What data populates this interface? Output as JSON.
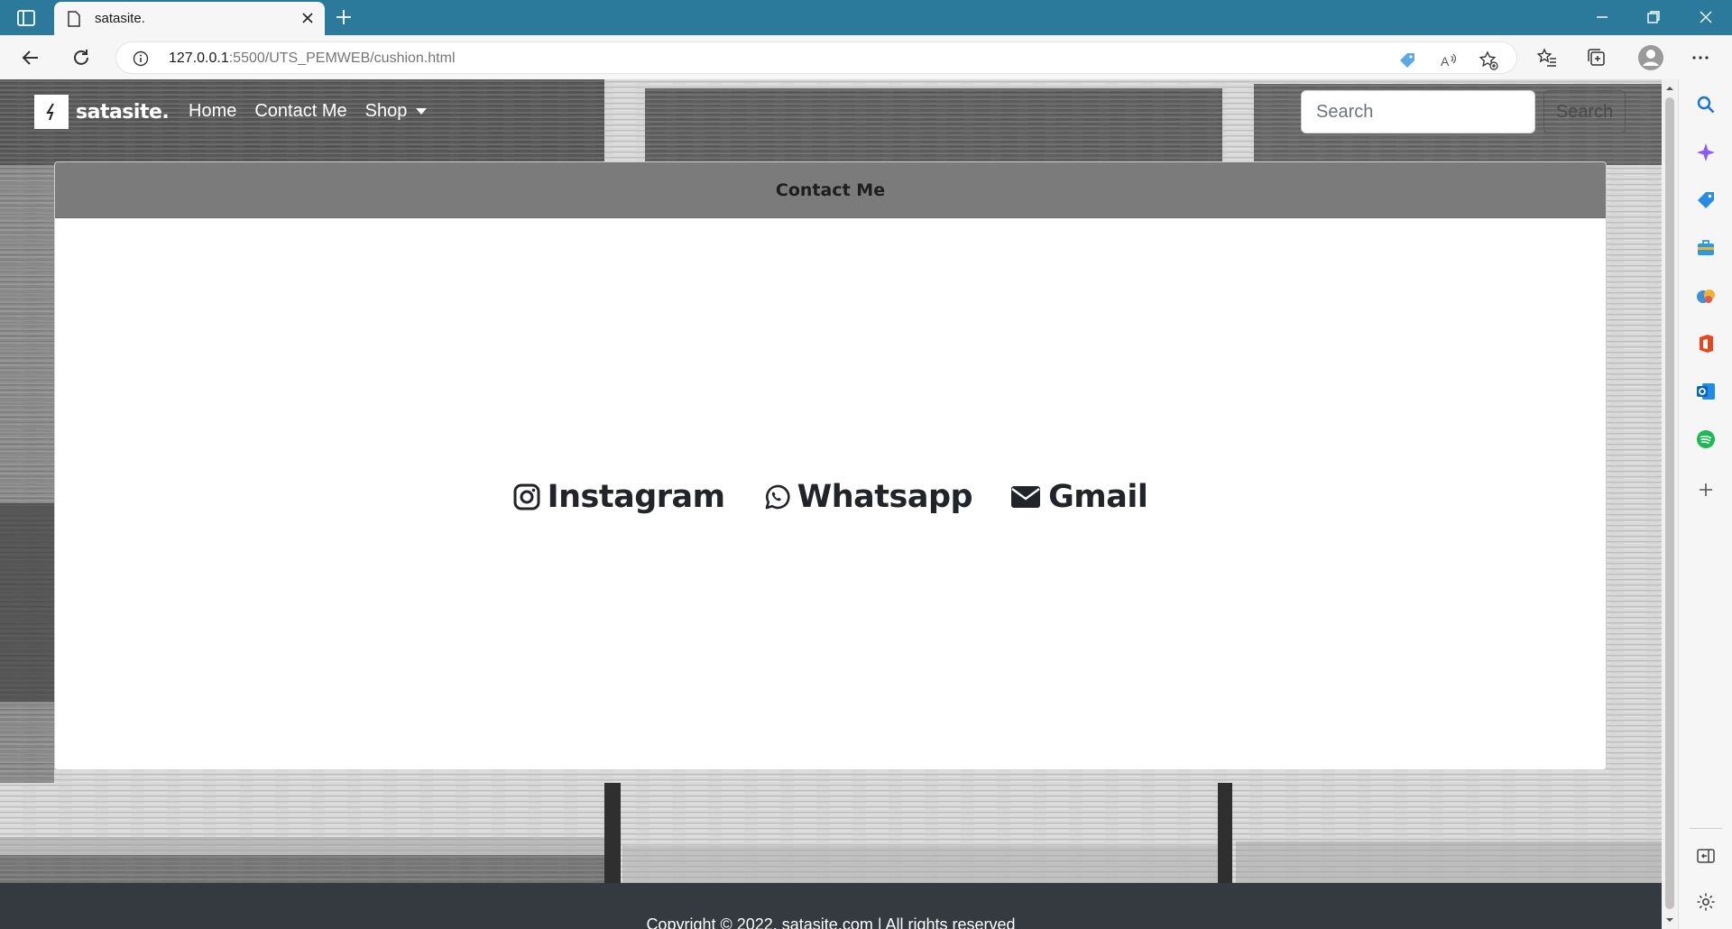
{
  "browser": {
    "tab_title": "satasite.",
    "url_host": "127.0.0.1",
    "url_rest": ":5500/UTS_PEMWEB/cushion.html"
  },
  "navbar": {
    "brand_name": "satasite.",
    "links": [
      {
        "label": "Home"
      },
      {
        "label": "Contact Me"
      },
      {
        "label": "Shop"
      }
    ],
    "search_placeholder": "Search",
    "search_button": "Search"
  },
  "card": {
    "title": "Contact Me",
    "contacts": [
      {
        "label": "Instagram",
        "icon": "instagram-icon"
      },
      {
        "label": "Whatsapp",
        "icon": "whatsapp-icon"
      },
      {
        "label": "Gmail",
        "icon": "envelope-icon"
      }
    ]
  },
  "footer": {
    "copyright": "Copyright © 2022, satasite.com | All rights reserved"
  },
  "colors": {
    "browser_accent": "#2b7a9b",
    "footer_bg": "#343a40",
    "card_header_bg": "#7b7b7b"
  }
}
